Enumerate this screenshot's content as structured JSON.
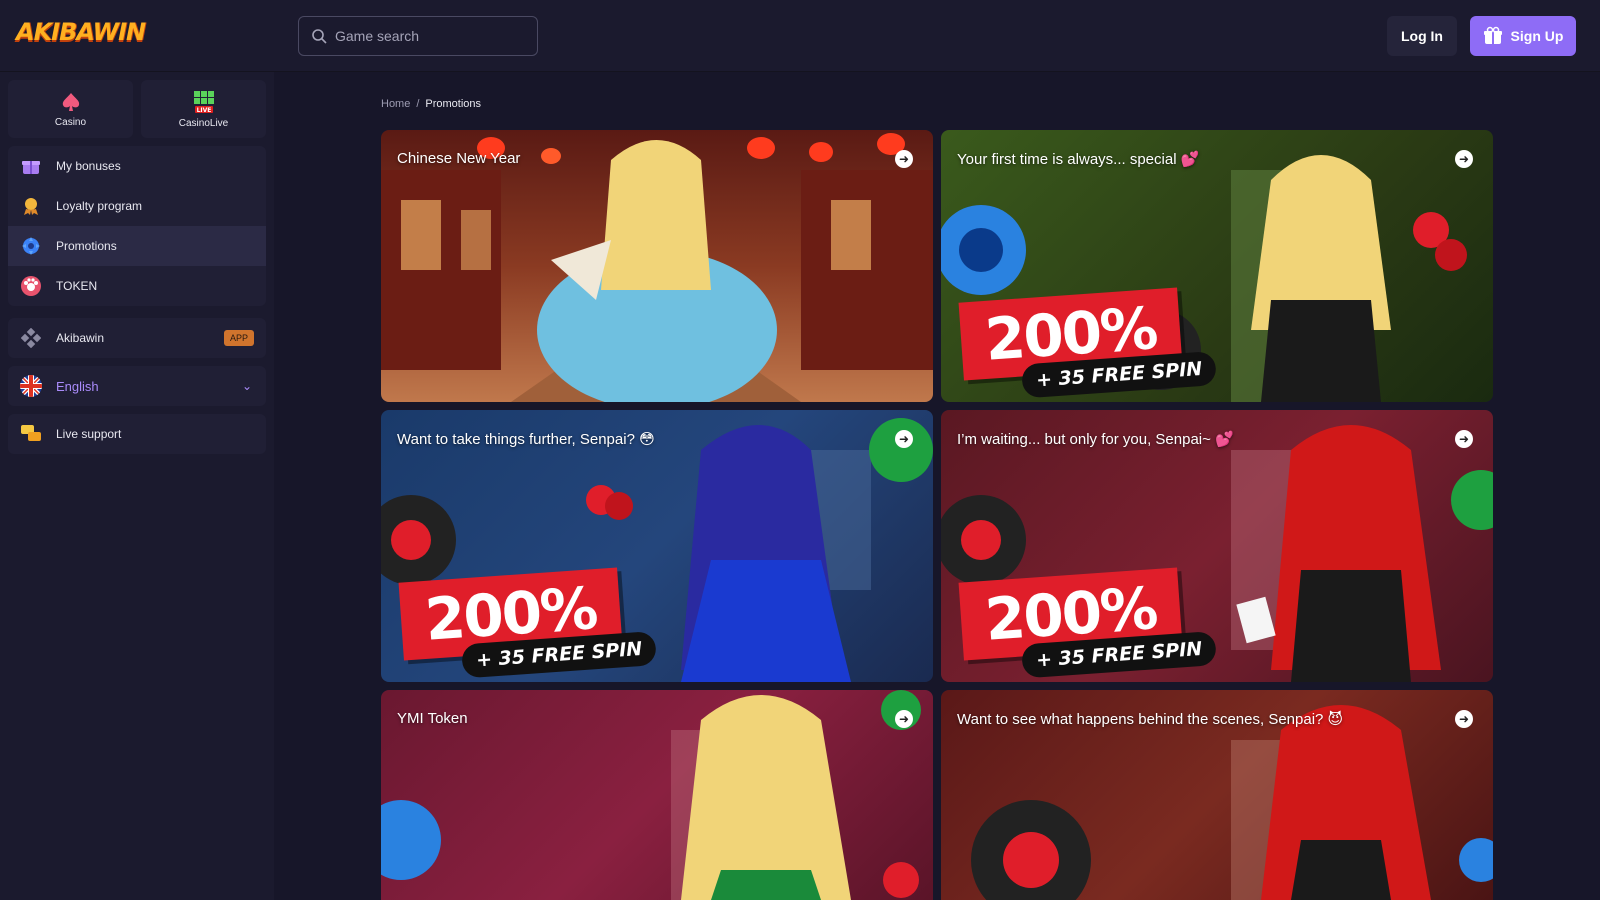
{
  "header": {
    "logo_text": "AKIBAWIN",
    "search_placeholder": "Game search",
    "login_label": "Log In",
    "signup_label": "Sign Up"
  },
  "sidebar": {
    "tabs": [
      {
        "label": "Casino",
        "icon": "spade-icon"
      },
      {
        "label": "CasinoLive",
        "icon": "live-grid-icon",
        "badge": "LIVE"
      }
    ],
    "menu": [
      {
        "label": "My bonuses",
        "icon": "gift-icon"
      },
      {
        "label": "Loyalty program",
        "icon": "loyalty-icon"
      },
      {
        "label": "Promotions",
        "icon": "promotions-icon",
        "active": true
      },
      {
        "label": "TOKEN",
        "icon": "token-icon"
      }
    ],
    "app_item": {
      "label": "Akibawin",
      "badge": "APP",
      "icon": "diamond-icon"
    },
    "language": {
      "label": "English",
      "icon": "uk-flag-icon"
    },
    "support": {
      "label": "Live support",
      "icon": "chat-icon"
    }
  },
  "breadcrumb": {
    "home": "Home",
    "separator": "/",
    "current": "Promotions"
  },
  "promotions": [
    {
      "title": "Chinese New Year",
      "badge_pct": "",
      "badge_spin": ""
    },
    {
      "title": "Your first time is always... special 💕",
      "badge_pct": "200%",
      "badge_spin": "+ 35 FREE SPIN"
    },
    {
      "title": "Want to take things further, Senpai? 😳",
      "badge_pct": "200%",
      "badge_spin": "+ 35 FREE SPIN"
    },
    {
      "title": "I’m waiting... but only for you, Senpai~ 💕",
      "badge_pct": "200%",
      "badge_spin": "+ 35 FREE SPIN"
    },
    {
      "title": "YMI Token",
      "badge_pct": "",
      "badge_spin": ""
    },
    {
      "title": "Want to see what happens behind the scenes, Senpai? 😈",
      "badge_pct": "",
      "badge_spin": ""
    }
  ],
  "colors": {
    "accent": "#8e6cf6",
    "background": "#171629",
    "sidebar": "#1b1a2e",
    "promo_red": "#e01e2a"
  }
}
